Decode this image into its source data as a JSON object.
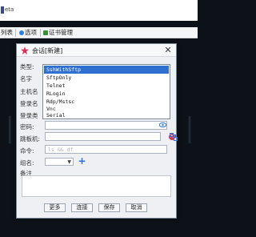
{
  "app": {
    "title": "eta"
  },
  "menubar": {
    "items": [
      "列表",
      "选项",
      "证书管理"
    ]
  },
  "background": {
    "art": "||||| ||||| |||"
  },
  "dialog": {
    "title": "会话[新建]",
    "close_label": "✕",
    "fields": {
      "type_label": "类型:",
      "name_label": "名字",
      "host_label": "主机名",
      "login_name_label": "登录名",
      "login_type_label": "登录类",
      "password_label": "密码:",
      "jump_label": "跳板机:",
      "command_label": "命令:",
      "command_placeholder": "ls && df",
      "group_label": "组名:",
      "notes_label": "备注"
    },
    "dropdown": {
      "options": [
        "SshWithSftp",
        "SftpOnly",
        "Telnet",
        "RLogin",
        "Rdp/Mstsc",
        "Vnc",
        "Serial"
      ],
      "selected": "SshWithSftp"
    },
    "buttons": {
      "more": "更多",
      "connect": "连接",
      "save": "保存",
      "cancel": "取消"
    }
  },
  "colors": {
    "accent": "#2f6fd0",
    "clear": "#d8355b",
    "terminal": "#0c1218"
  }
}
